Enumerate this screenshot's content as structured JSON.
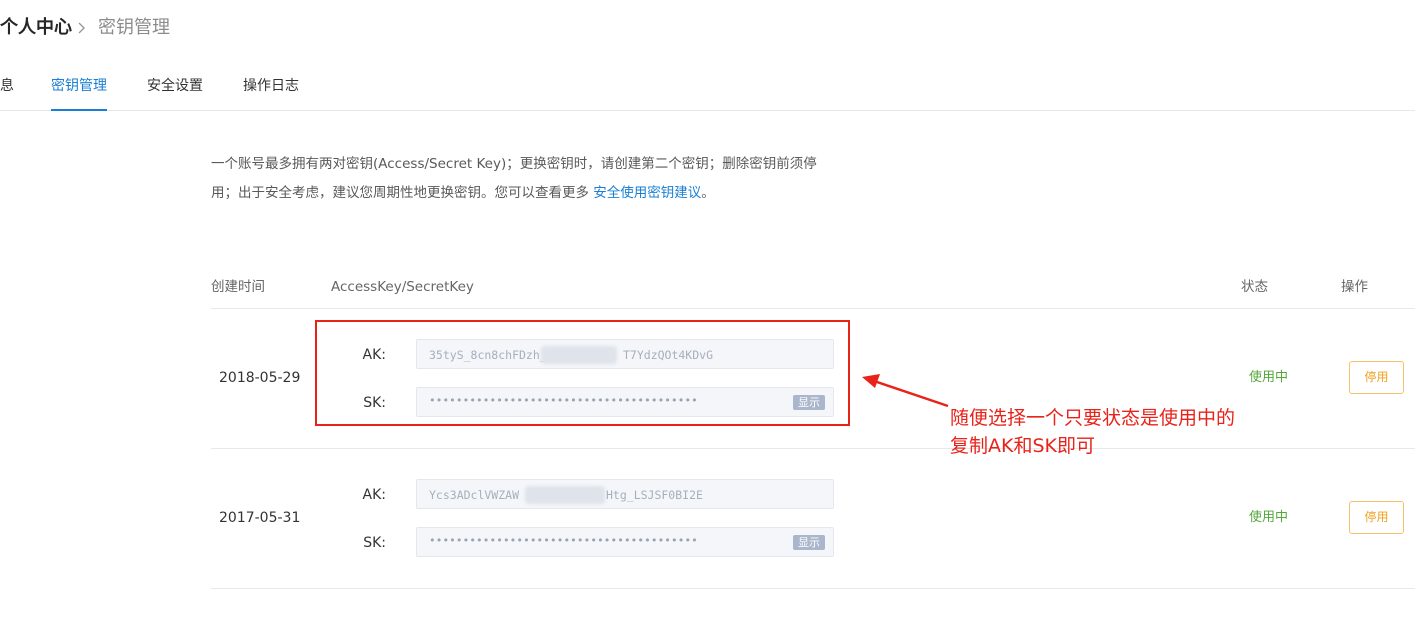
{
  "breadcrumb": {
    "current": "个人中心",
    "page": "密钥管理"
  },
  "tabs": [
    {
      "label": "息",
      "active": false
    },
    {
      "label": "密钥管理",
      "active": true
    },
    {
      "label": "安全设置",
      "active": false
    },
    {
      "label": "操作日志",
      "active": false
    }
  ],
  "notice": {
    "line1": "一个账号最多拥有两对密钥(Access/Secret Key)；更换密钥时，请创建第二个密钥；删除密钥前须停",
    "line2_prefix": "用；出于安全考虑，建议您周期性地更换密钥。您可以查看更多 ",
    "link": "安全使用密钥建议",
    "line2_suffix": "。"
  },
  "table": {
    "headers": {
      "created": "创建时间",
      "keys": "AccessKey/SecretKey",
      "status": "状态",
      "action": "操作"
    },
    "rows": [
      {
        "date": "2018-05-29",
        "ak_label": "AK:",
        "ak_prefix": "35tyS_8cn8chFDzh_",
        "ak_suffix": "T7YdzQOt4KDvG",
        "sk_label": "SK:",
        "sk_value": "••••••••••••••••••••••••••••••••••••••••",
        "show_label": "显示",
        "status": "使用中",
        "action_label": "停用"
      },
      {
        "date": "2017-05-31",
        "ak_label": "AK:",
        "ak_prefix": "Ycs3ADclVWZAW",
        "ak_suffix": "Htg_LSJSF0BI2E",
        "sk_label": "SK:",
        "sk_value": "••••••••••••••••••••••••••••••••••••••••",
        "show_label": "显示",
        "status": "使用中",
        "action_label": "停用"
      }
    ]
  },
  "annotation": {
    "line1": "随便选择一个只要状态是使用中的",
    "line2": "复制AK和SK即可",
    "color": "#e8231a"
  },
  "colors": {
    "accent": "#1a7fd4",
    "status_active": "#52a63a",
    "warn": "#f0a020"
  },
  "icons": {
    "separator": "chevron-right-icon"
  }
}
